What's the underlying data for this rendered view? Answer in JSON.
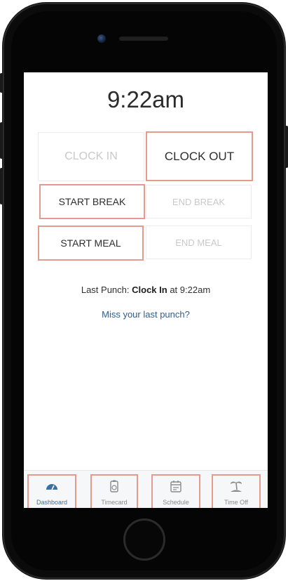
{
  "clock": {
    "time": "9:22am"
  },
  "punch_buttons": {
    "clock_in": "CLOCK IN",
    "clock_out": "CLOCK OUT",
    "start_break": "START BREAK",
    "end_break": "END BREAK",
    "start_meal": "START MEAL",
    "end_meal": "END MEAL"
  },
  "last_punch": {
    "prefix": "Last Punch: ",
    "action": "Clock In",
    "middle": " at ",
    "time": "9:22am"
  },
  "miss_link": "Miss your last punch?",
  "nav": {
    "items": [
      {
        "label": "Dashboard",
        "icon": "gauge-icon"
      },
      {
        "label": "Timecard",
        "icon": "timecard-icon"
      },
      {
        "label": "Schedule",
        "icon": "calendar-icon"
      },
      {
        "label": "Time Off",
        "icon": "palm-tree-icon"
      }
    ]
  },
  "colors": {
    "highlight": "#e59a8e",
    "link": "#2f5d8c",
    "active_nav": "#3b6ea5"
  }
}
